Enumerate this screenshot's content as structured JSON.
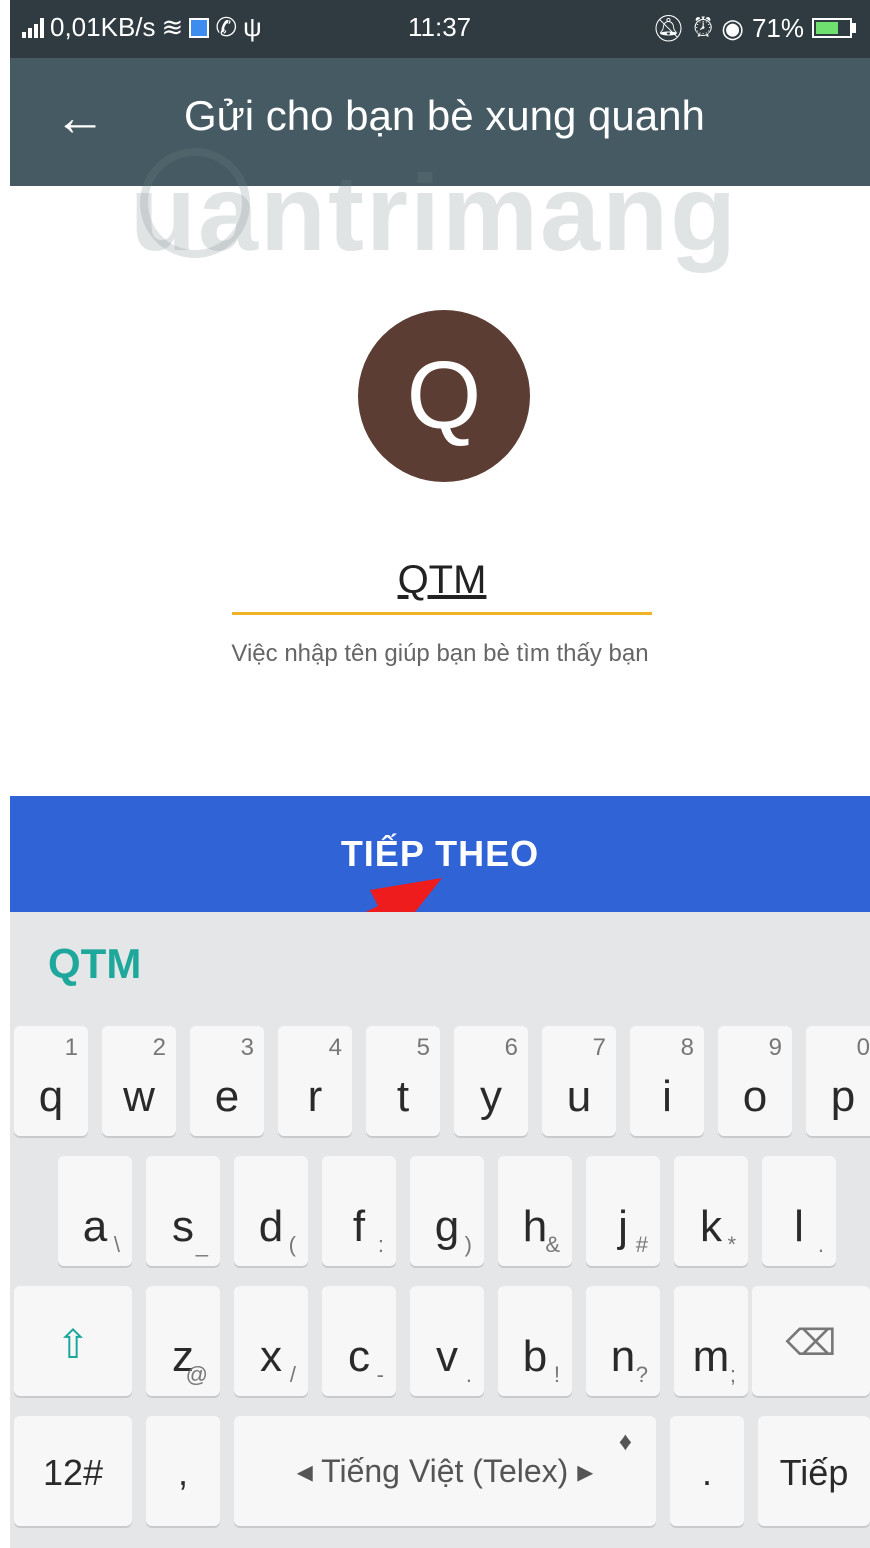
{
  "status_bar": {
    "network_speed": "0,01KB/s",
    "time": "11:37",
    "battery": "71%",
    "icons": [
      "signal-icon",
      "wifi-icon",
      "app-icon",
      "viber-icon",
      "usb-icon",
      "mute-icon",
      "alarm-icon",
      "eye-icon",
      "battery-icon"
    ]
  },
  "toolbar": {
    "back_icon": "←",
    "title": "Gửi cho bạn bè xung quanh"
  },
  "watermark": "uantrimang",
  "profile": {
    "avatar_letter": "Q",
    "avatar_color": "#5b3d33",
    "name_value": "QTM",
    "hint": "Việc nhập tên giúp bạn bè tìm thấy bạn",
    "underline_color": "#f0b325"
  },
  "next_button": {
    "label": "TIẾP THEO",
    "color": "#2f63d6"
  },
  "keyboard": {
    "suggestion": "QTM",
    "row1": [
      {
        "key": "q",
        "hint": "1"
      },
      {
        "key": "w",
        "hint": "2"
      },
      {
        "key": "e",
        "hint": "3"
      },
      {
        "key": "r",
        "hint": "4"
      },
      {
        "key": "t",
        "hint": "5"
      },
      {
        "key": "y",
        "hint": "6"
      },
      {
        "key": "u",
        "hint": "7"
      },
      {
        "key": "i",
        "hint": "8"
      },
      {
        "key": "o",
        "hint": "9"
      },
      {
        "key": "p",
        "hint": "0"
      }
    ],
    "row2": [
      {
        "key": "a",
        "hint": "\\"
      },
      {
        "key": "s",
        "hint": "_"
      },
      {
        "key": "d",
        "hint": "("
      },
      {
        "key": "f",
        "hint": ":"
      },
      {
        "key": "g",
        "hint": ")"
      },
      {
        "key": "h",
        "hint": "&"
      },
      {
        "key": "j",
        "hint": "#"
      },
      {
        "key": "k",
        "hint": "*"
      },
      {
        "key": "l",
        "hint": "."
      }
    ],
    "row3": [
      {
        "key": "z",
        "hint": "@"
      },
      {
        "key": "x",
        "hint": "/"
      },
      {
        "key": "c",
        "hint": "-"
      },
      {
        "key": "v",
        "hint": "."
      },
      {
        "key": "b",
        "hint": "!"
      },
      {
        "key": "n",
        "hint": "?"
      },
      {
        "key": "m",
        "hint": ";"
      }
    ],
    "shift_icon": "⇧",
    "backspace_icon": "⌫",
    "symbols_label": "12#",
    "comma_label": ",",
    "space_label": "◂ Tiếng Việt (Telex) ▸",
    "mic_icon": "🎤",
    "period_label": ".",
    "enter_label": "Tiếp"
  }
}
